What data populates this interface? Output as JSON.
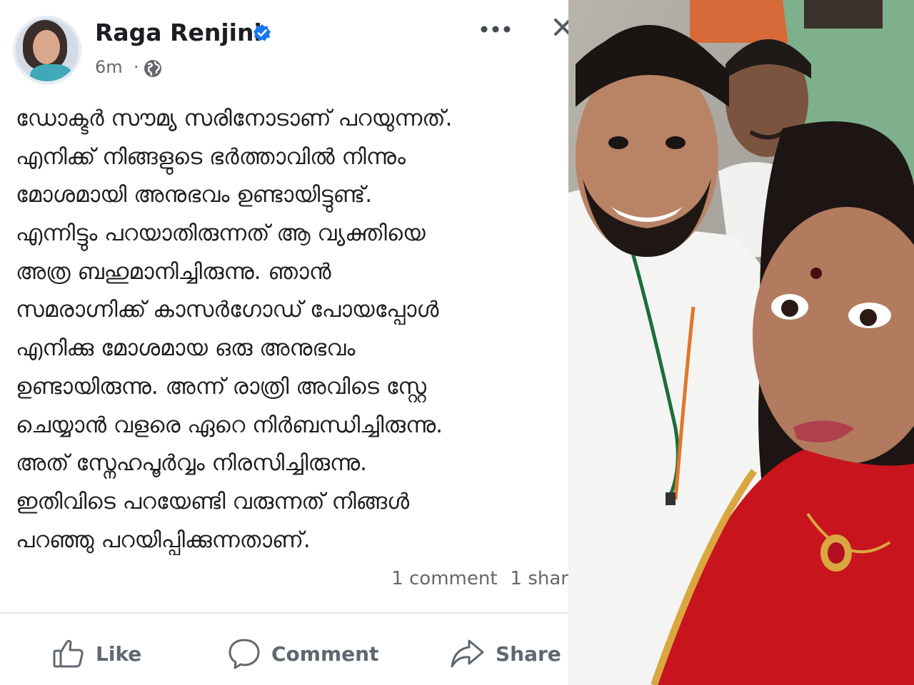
{
  "post": {
    "author": "Raga Renjini",
    "time": "6m",
    "separator": "·",
    "text_lines": [
      "ഡോക്ടർ സൗമ്യ സരിനോടാണ് പറയുന്നത്.",
      "എനിക്ക് നിങ്ങളുടെ ഭർത്താവിൽ നിന്നും",
      "മോശമായി അനുഭവം ഉണ്ടായിട്ടുണ്ട്.",
      "എന്നിട്ടും പറയാതിരുന്നത് ആ വ്യക്തിയെ",
      "അത്ര ബഹുമാനിച്ചിരുന്നു. ഞാൻ",
      "സമരാഗ്നിക്ക് കാസർഗോഡ് പോയപ്പോൾ",
      "എനിക്കു മോശമായ ഒരു അനുഭവം",
      "ഉണ്ടായിരുന്നു. അന്ന് രാത്രി അവിടെ സ്റ്റേ",
      "ചെയ്യാൻ വളരെ ഏറെ നിർബന്ധിച്ചിരുന്നു.",
      "അത് സ്നേഹപൂർവ്വം നിരസിച്ചിരുന്നു.",
      "ഇതിവിടെ പറയേണ്ടി വരുന്നത് നിങ്ങൾ",
      "പറഞ്ഞു പറയിപ്പിക്കുന്നതാണ്."
    ],
    "comments": "1 comment",
    "shares": "1 shar"
  },
  "actions": {
    "like": "Like",
    "comment": "Comment",
    "share": "Share"
  },
  "icons": {
    "verified": "verified-badge-icon",
    "globe": "globe-icon",
    "more": "more-options-icon",
    "close": "close-icon",
    "like": "thumbs-up-icon",
    "comment": "speech-bubble-icon",
    "share": "share-arrow-icon"
  },
  "colors": {
    "verified_blue": "#1877f2",
    "text": "#1c1e21",
    "muted": "#65676b",
    "saree_red": "#c8141c"
  }
}
